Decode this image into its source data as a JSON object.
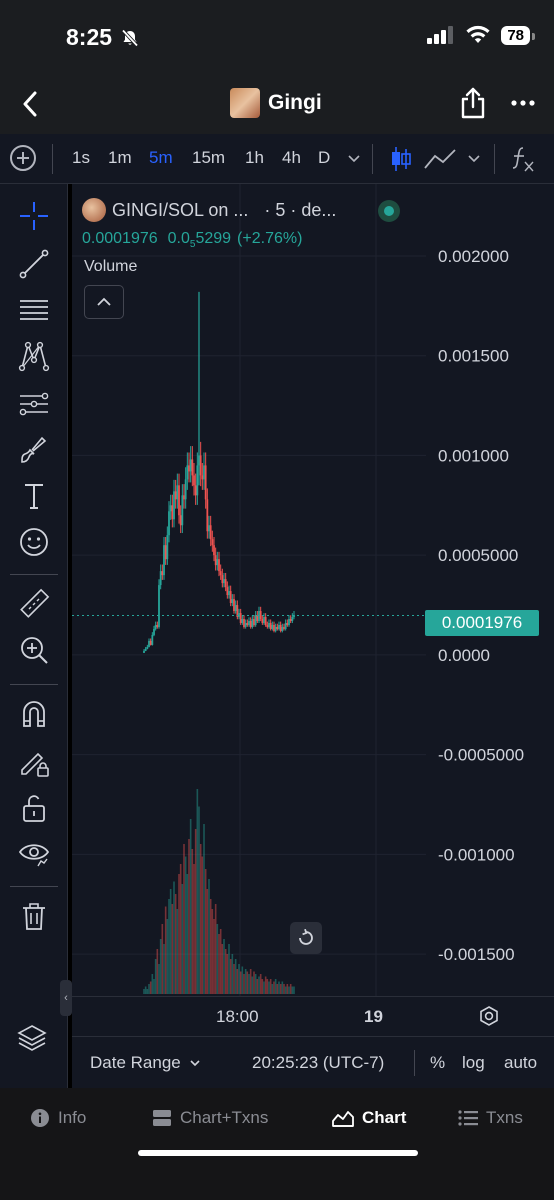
{
  "status": {
    "time": "8:25",
    "battery": "78"
  },
  "nav": {
    "title": "Gingi"
  },
  "toolbar": {
    "timeframes": [
      "1s",
      "1m",
      "5m",
      "15m",
      "1h",
      "4h",
      "D"
    ],
    "active_timeframe": "5m"
  },
  "chart": {
    "symbol": "GINGI/SOL on ...",
    "interval": "· 5 · de...",
    "price": "0.0001976",
    "change_prefix": "0.0",
    "change_sub": "5",
    "change_suffix": "5299",
    "change_pct": "(+2.76%)",
    "volume_label": "Volume",
    "current_price_tag": "0.0001976",
    "time_labels": [
      "18:00",
      "19"
    ],
    "colors": {
      "up": "#26a69a",
      "down": "#ef5350",
      "accent": "#2962ff",
      "bg": "#131722"
    }
  },
  "chart_data": {
    "type": "candlestick",
    "title": "",
    "xlabel": "",
    "ylabel": "",
    "y_ticks": [
      "0.002000",
      "0.001500",
      "0.001000",
      "0.0005000",
      "0.0000",
      "-0.0005000",
      "-0.001000",
      "-0.001500"
    ],
    "ylim": [
      -0.00168,
      0.00205
    ],
    "x_ticks": [
      "18:00",
      "19"
    ],
    "current_price": 0.0001976,
    "close_series": [
      2e-05,
      3e-05,
      4e-05,
      7e-05,
      5e-05,
      0.0001,
      0.00013,
      0.00015,
      0.00014,
      0.00035,
      0.00042,
      0.0004,
      0.00055,
      0.00048,
      0.0006,
      0.00072,
      0.00075,
      0.00068,
      0.00082,
      0.00078,
      0.00085,
      0.0007,
      0.00065,
      0.0008,
      0.00078,
      0.00088,
      0.00095,
      0.00092,
      0.00098,
      0.0009,
      0.00085,
      0.0008,
      0.00095,
      0.001,
      0.0009,
      0.00088,
      0.00095,
      0.00078,
      0.00062,
      0.00065,
      0.00058,
      0.00055,
      0.0005,
      0.00045,
      0.00048,
      0.00042,
      0.0004,
      0.00036,
      0.00038,
      0.00034,
      0.0003,
      0.00032,
      0.00026,
      0.00028,
      0.00022,
      0.00025,
      0.00019,
      0.00021,
      0.00016,
      0.00018,
      0.00014,
      0.00016,
      0.00015,
      0.00017,
      0.00014,
      0.00018,
      0.00015,
      0.0002,
      0.00017,
      0.00022,
      0.00018,
      0.00016,
      0.00019,
      0.00015,
      0.00014,
      0.00016,
      0.00013,
      0.00015,
      0.00012,
      0.00014,
      0.00013,
      0.00015,
      0.00012,
      0.00014,
      0.00013,
      0.00016,
      0.00015,
      0.00018,
      0.00017,
      0.00019,
      0.0002
    ],
    "wick_max": 0.00182,
    "volume_series": [
      2,
      3,
      2,
      4,
      5,
      8,
      6,
      14,
      18,
      12,
      22,
      28,
      20,
      35,
      30,
      38,
      42,
      36,
      45,
      40,
      34,
      48,
      52,
      44,
      60,
      55,
      48,
      62,
      70,
      58,
      52,
      66,
      82,
      75,
      60,
      55,
      68,
      50,
      42,
      46,
      38,
      34,
      30,
      36,
      28,
      24,
      26,
      20,
      22,
      18,
      16,
      20,
      14,
      16,
      12,
      14,
      10,
      12,
      9,
      11,
      8,
      10,
      9,
      8,
      10,
      7,
      9,
      8,
      6,
      7,
      8,
      6,
      5,
      7,
      6,
      5,
      6,
      4,
      5,
      6,
      4,
      5,
      4,
      5,
      4,
      3,
      4,
      3,
      4,
      3,
      3
    ]
  },
  "bottom": {
    "date_range": "Date Range",
    "clock": "20:25:23 (UTC-7)",
    "percent": "%",
    "log": "log",
    "auto": "auto"
  },
  "tabs": [
    {
      "label": "Info"
    },
    {
      "label": "Chart+Txns"
    },
    {
      "label": "Chart"
    },
    {
      "label": "Txns"
    }
  ]
}
